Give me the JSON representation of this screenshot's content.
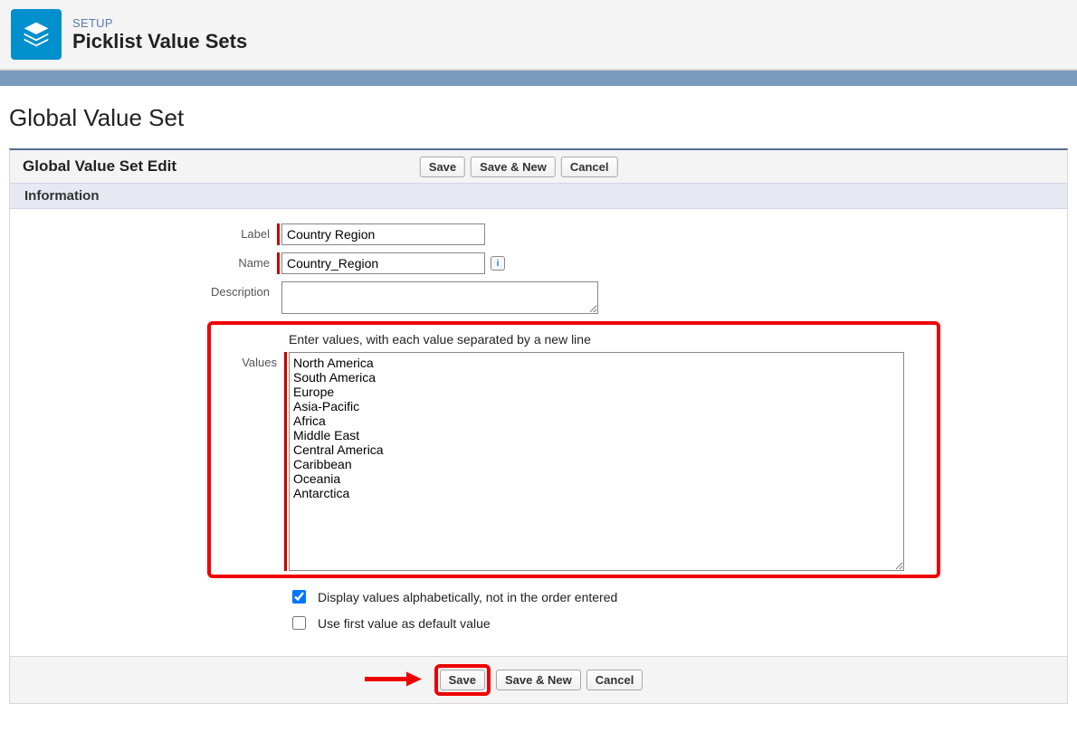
{
  "header": {
    "setup_label": "SETUP",
    "page_title": "Picklist Value Sets"
  },
  "page": {
    "title": "Global Value Set",
    "edit_title": "Global Value Set Edit",
    "section": "Information"
  },
  "buttons": {
    "save": "Save",
    "save_new": "Save & New",
    "cancel": "Cancel"
  },
  "fields": {
    "label_label": "Label",
    "label_value": "Country Region",
    "name_label": "Name",
    "name_value": "Country_Region",
    "description_label": "Description",
    "description_value": "",
    "values_label": "Values",
    "values_hint": "Enter values, with each value separated by a new line",
    "values_content": "North America\nSouth America\nEurope\nAsia-Pacific\nAfrica\nMiddle East\nCentral America\nCaribbean\nOceania\nAntarctica",
    "alpha_label": "Display values alphabetically, not in the order entered",
    "alpha_checked": true,
    "default_label": "Use first value as default value",
    "default_checked": false
  },
  "icons": {
    "info": "i"
  }
}
